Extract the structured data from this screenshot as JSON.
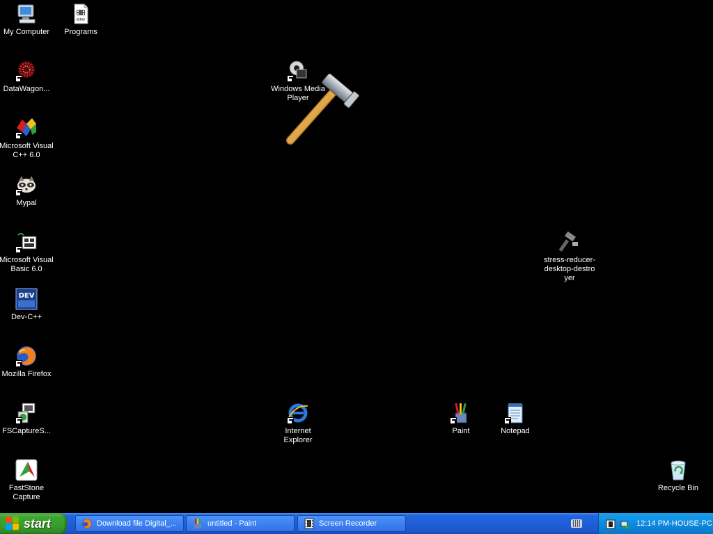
{
  "desktop": {
    "icons": {
      "my_computer": "My Computer",
      "programs": "Programs",
      "datawagon": "DataWagon...",
      "msvc": "Microsoft Visual\nC++ 6.0",
      "mypal": "Mypal",
      "msvb": "Microsoft Visual\nBasic 6.0",
      "devcpp": "Dev-C++",
      "firefox": "Mozilla Firefox",
      "fscapture": "FSCaptureS...",
      "faststone": "FastStone\nCapture",
      "wmp": "Windows Media\nPlayer",
      "stress": "stress-reducer-\ndesktop-destro\nyer",
      "ie": "Internet\nExplorer",
      "paint": "Paint",
      "notepad": "Notepad",
      "recycle": "Recycle Bin"
    }
  },
  "taskbar": {
    "start_label": "start",
    "tasks": [
      {
        "label": "Download file Digital_..."
      },
      {
        "label": "untitled - Paint"
      },
      {
        "label": "Screen Recorder"
      }
    ],
    "clock": "12:14 PM-HOUSE-PC"
  },
  "colors": {
    "taskbar": "#1f5fd8",
    "start": "#3da630",
    "tray": "#0f8ade"
  }
}
